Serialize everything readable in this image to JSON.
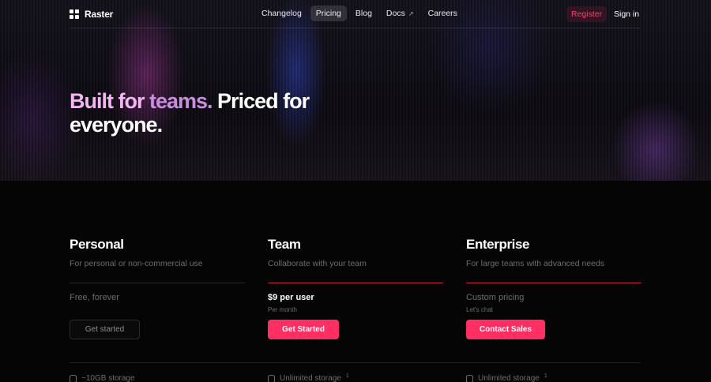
{
  "app": {
    "name": "Raster"
  },
  "nav": {
    "links": [
      {
        "label": "Changelog"
      },
      {
        "label": "Pricing",
        "active": true
      },
      {
        "label": "Blog"
      },
      {
        "label": "Docs",
        "external_icon": "arrow-up-right-icon"
      },
      {
        "label": "Careers"
      }
    ],
    "register_label": "Register",
    "signin_label": "Sign in"
  },
  "hero": {
    "title_part1": "Built for ",
    "title_part2": "teams.",
    "title_part3": " Priced for everyone."
  },
  "plans": [
    {
      "name": "Personal",
      "description": "For personal or non-commercial use",
      "price": "Free, forever",
      "price_note": "",
      "cta": "Get started",
      "feature": "~10GB storage",
      "feature_sup": ""
    },
    {
      "name": "Team",
      "description": "Collaborate with your team",
      "price": "$9 per user",
      "price_note": "Per month",
      "cta": "Get Started",
      "feature": "Unlimited storage",
      "feature_sup": "1"
    },
    {
      "name": "Enterprise",
      "description": "For large teams with advanced needs",
      "price": "Custom pricing",
      "price_note": "Let's chat",
      "cta": "Contact Sales",
      "feature": "Unlimited storage",
      "feature_sup": "1"
    }
  ],
  "colors": {
    "accent": "#ff2e63",
    "register_text": "#ff3d6e",
    "rule_accent": "#c21f4a",
    "background": "#050505",
    "muted_text": "#6d6d72"
  },
  "icons": {
    "logo": "four-squares-logo-icon",
    "feature": "database-icon"
  }
}
